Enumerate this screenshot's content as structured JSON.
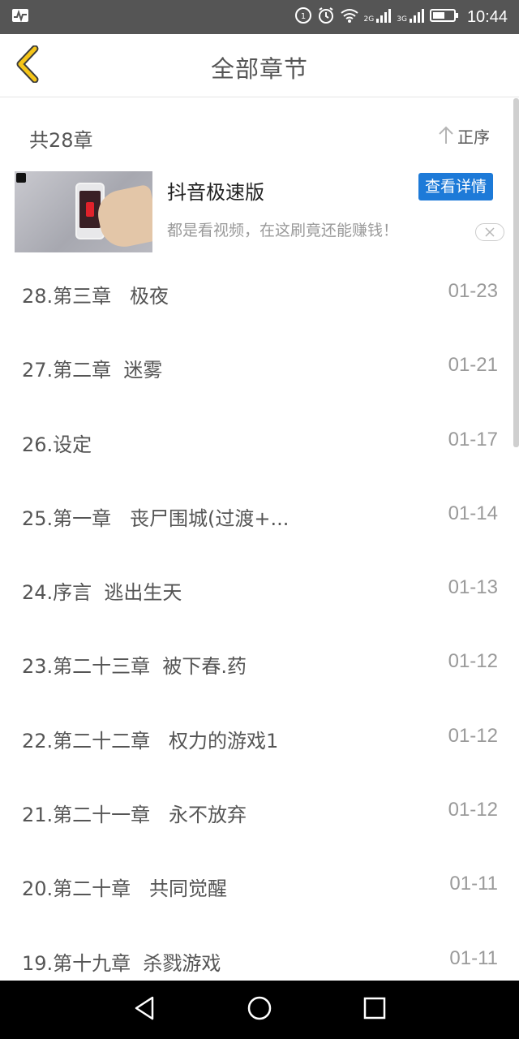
{
  "status_bar": {
    "time": "10:44",
    "network_1": "2G",
    "network_2": "3G",
    "icons": [
      "activity-icon",
      "data-saver-icon",
      "alarm-icon",
      "wifi-icon",
      "signal-icon",
      "battery-icon"
    ]
  },
  "header": {
    "title": "全部章节",
    "back_icon": "chevron-left-icon",
    "accent_color": "#f5c518"
  },
  "summary": {
    "count_label": "共28章",
    "sort_label": "正序",
    "sort_icon": "arrow-up-icon"
  },
  "ad": {
    "title": "抖音极速版",
    "description": "都是看视频，在这刷竟还能赚钱！",
    "button_label": "查看详情",
    "button_color": "#1d7ad8",
    "close_icon": "close-icon"
  },
  "chapters": [
    {
      "title": "28.第三章   极夜",
      "date": "01-23"
    },
    {
      "title": "27.第二章  迷雾",
      "date": "01-21"
    },
    {
      "title": "26.设定",
      "date": "01-17"
    },
    {
      "title": "25.第一章   丧尸围城(过渡+...",
      "date": "01-14"
    },
    {
      "title": "24.序言  逃出生天",
      "date": "01-13"
    },
    {
      "title": "23.第二十三章  被下春.药",
      "date": "01-12"
    },
    {
      "title": "22.第二十二章   权力的游戏1",
      "date": "01-12"
    },
    {
      "title": "21.第二十一章   永不放弃",
      "date": "01-12"
    },
    {
      "title": "20.第二十章   共同觉醒",
      "date": "01-11"
    },
    {
      "title": "19.第十九章  杀戮游戏",
      "date": "01-11"
    }
  ],
  "nav_bar": {
    "back_icon": "triangle-back-icon",
    "home_icon": "circle-home-icon",
    "recents_icon": "square-recents-icon"
  }
}
